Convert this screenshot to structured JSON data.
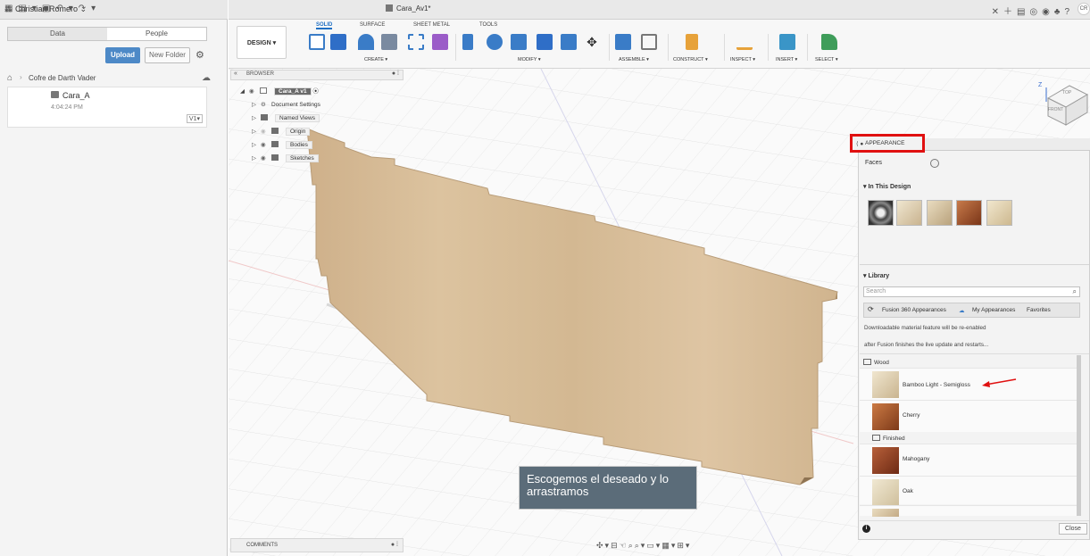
{
  "data_panel": {
    "user": "Christian Romero",
    "tabs": [
      "Data",
      "People"
    ],
    "upload_label": "Upload",
    "new_folder_label": "New Folder",
    "breadcrumb": "Cofre de Darth Vader",
    "file": {
      "name": "Cara_A",
      "time": "4:04:24 PM",
      "version": "V1"
    }
  },
  "app": {
    "document_title": "Cara_Av1*",
    "avatar": "CR"
  },
  "toolbar": {
    "workspace": "DESIGN",
    "tabs": [
      "SOLID",
      "SURFACE",
      "SHEET METAL",
      "TOOLS"
    ],
    "groups": [
      "CREATE",
      "MODIFY",
      "ASSEMBLE",
      "CONSTRUCT",
      "INSPECT",
      "INSERT",
      "SELECT"
    ]
  },
  "browser": {
    "title": "BROWSER",
    "root": "Cara_A v1",
    "items": [
      "Document Settings",
      "Named Views",
      "Origin",
      "Bodies",
      "Sketches"
    ]
  },
  "comments": {
    "title": "COMMENTS"
  },
  "annotation": "Escogemos el deseado y lo arrastramos",
  "viewcube": {
    "top": "TOP",
    "front": "FRONT",
    "axis": "Z"
  },
  "appearance": {
    "title": "APPEARANCE",
    "faces_label": "Faces",
    "in_this_design": "In This Design",
    "library": "Library",
    "search_placeholder": "Search",
    "lib_tabs": [
      "Fusion 360 Appearances",
      "My Appearances",
      "Favorites"
    ],
    "note1": "Downloadable material feature will be re-enabled",
    "note2": "after Fusion finishes the live update and restarts...",
    "folder_wood": "Wood",
    "folder_finished": "Finished",
    "materials": [
      "Bamboo Light - Semigloss",
      "Cherry",
      "Mahogany",
      "Oak"
    ],
    "close_label": "Close"
  },
  "colors": {
    "accent": "#1f6fc4",
    "highlight": "#e01010",
    "callout": "#5b6c79",
    "wood": "#d8bd97"
  }
}
